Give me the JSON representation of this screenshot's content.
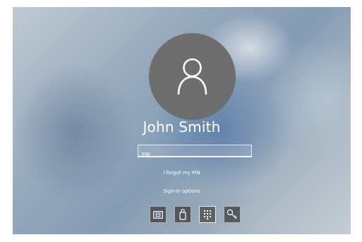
{
  "user": {
    "name": "John Smith"
  },
  "pin_field": {
    "placeholder": "PIN",
    "value": ""
  },
  "links": {
    "forgot_pin": "I forgot my PIN",
    "signin_options": "Sign-in options"
  },
  "signin_methods": [
    {
      "icon": "smartcard-icon",
      "selected": false
    },
    {
      "icon": "security-key-icon",
      "selected": false
    },
    {
      "icon": "pin-keypad-icon",
      "selected": true
    },
    {
      "icon": "password-key-icon",
      "selected": false
    }
  ],
  "colors": {
    "avatar_bg": "#6e6e6e",
    "text": "#ffffff",
    "option_bg": "#3c3c3c"
  }
}
